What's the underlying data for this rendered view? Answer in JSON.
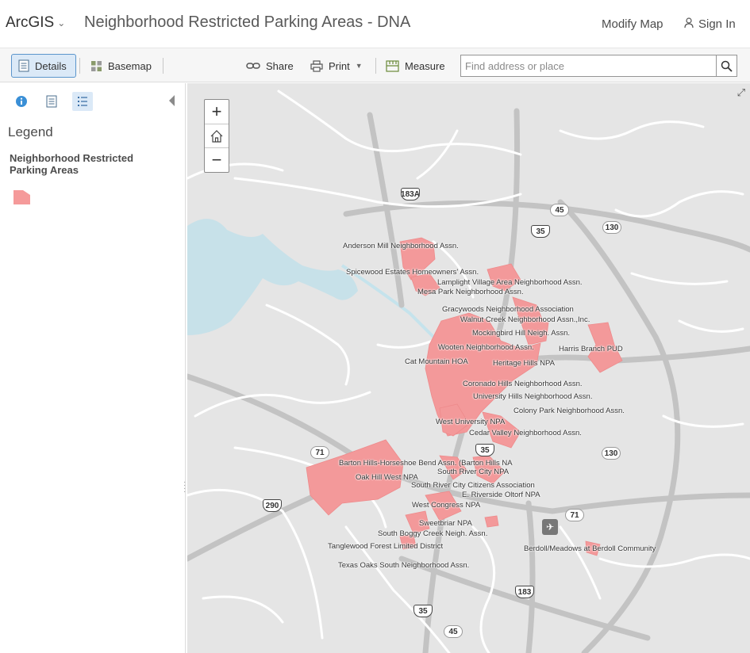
{
  "header": {
    "brand": "ArcGIS",
    "title": "Neighborhood Restricted Parking Areas - DNA",
    "modify_map": "Modify Map",
    "sign_in": "Sign In"
  },
  "toolbar": {
    "details": "Details",
    "basemap": "Basemap",
    "share": "Share",
    "print": "Print",
    "measure": "Measure",
    "search_placeholder": "Find address or place"
  },
  "panel": {
    "legend_heading": "Legend",
    "layer_name": "Neighborhood Restricted Parking Areas",
    "swatch_color": "#f59a9a"
  },
  "map": {
    "zoom_in": "+",
    "zoom_out": "−",
    "labels": [
      "Anderson Mill Neighborhood Assn.",
      "Spicewood Estates Homeowners' Assn.",
      "Lamplight Village Area Neighborhood Assn.",
      "Mesa Park Neighborhood Assn.",
      "Gracywoods Neighborhood Association",
      "Walnut Creek Neighborhood Assn.,Inc.",
      "Mockingbird Hill Neigh. Assn.",
      "Wooten Neighborhood Assn.",
      "Harris Branch PUD",
      "Cat Mountain HOA",
      "Heritage Hills NPA",
      "Coronado Hills Neighborhood Assn.",
      "University Hills Neighborhood Assn.",
      "Colony Park Neighborhood Assn.",
      "West University NPA",
      "Cedar Valley Neighborhood Assn.",
      "Barton Hills-Horseshoe Bend Assn. (Barton Hills NA",
      "South River City NPA",
      "Oak Hill West NPA",
      "South River City Citizens Association",
      "E. Riverside Oltorf NPA",
      "West Congress NPA",
      "Sweetbriar NPA",
      "South Boggy Creek Neigh. Assn.",
      "Tanglewood Forest Limited District",
      "Berdoll/Meadows at Berdoll Community",
      "Texas Oaks South Neighborhood Assn."
    ],
    "shields": [
      "183A",
      "45",
      "35",
      "130",
      "35",
      "71",
      "130",
      "290",
      "71",
      "183",
      "35",
      "45"
    ]
  }
}
